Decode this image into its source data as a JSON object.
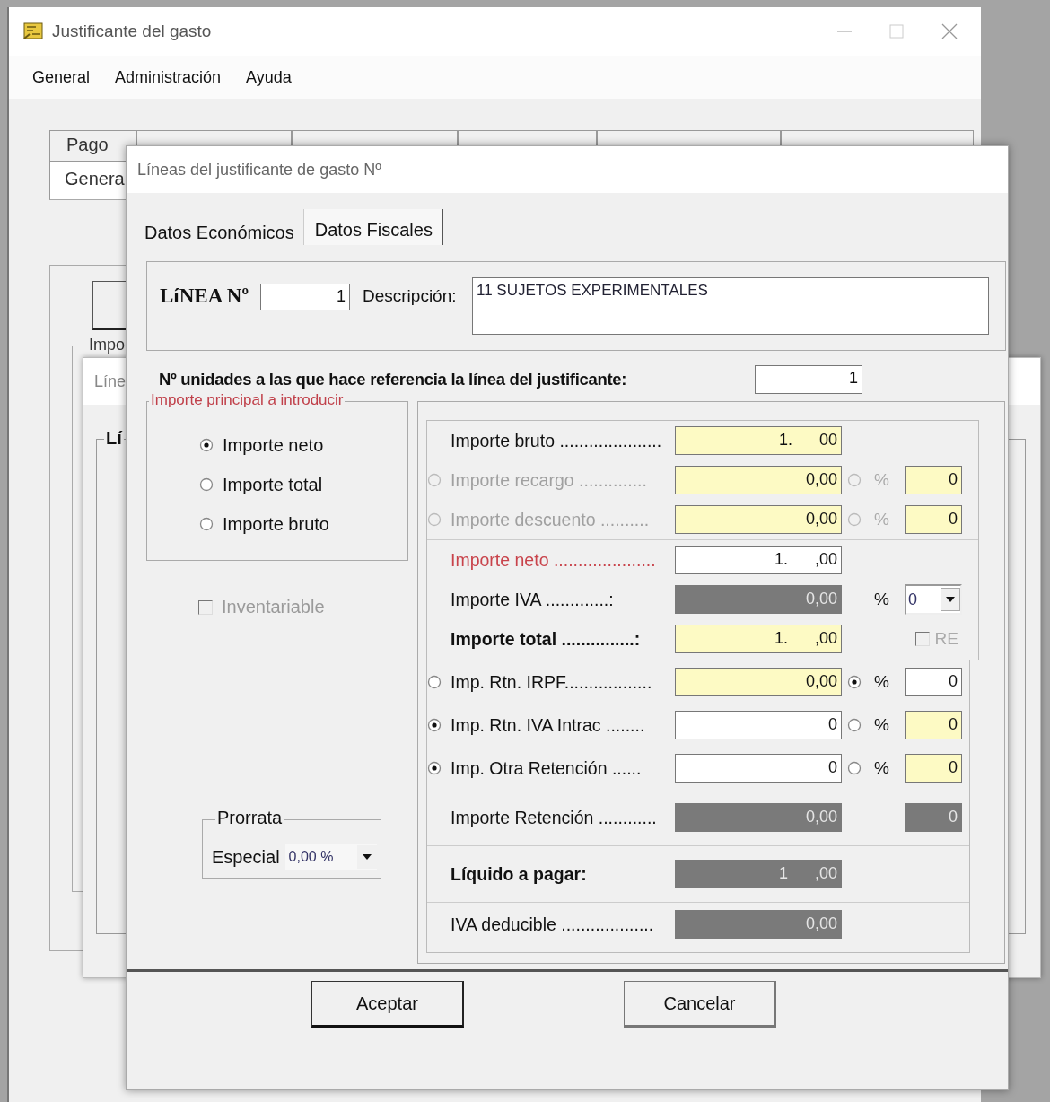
{
  "main_window": {
    "title": "Justificante del gasto",
    "menu": [
      "General",
      "Administración",
      "Ayuda"
    ],
    "tabs": [
      {
        "label": "Pago",
        "selected": false
      },
      {
        "label": "Genera",
        "selected": true
      }
    ],
    "group_label": "Impo"
  },
  "back_dialog": {
    "title": "Líne",
    "group_label": "Lí"
  },
  "dialog": {
    "title": "Líneas del justificante de gasto Nº",
    "tabs": [
      {
        "label": "Datos Económicos",
        "selected": true
      },
      {
        "label": "Datos Fiscales",
        "selected": false
      }
    ],
    "line_label": "LíNEA Nº",
    "line_value": "1",
    "description_label": "Descripción:",
    "description": "11 SUJETOS EXPERIMENTALES",
    "units_label": "Nº unidades a las que hace referencia la línea del justificante:",
    "units_value": "1",
    "principal": {
      "title": "Importe principal a introducir",
      "options": [
        {
          "label": "Importe neto",
          "selected": true
        },
        {
          "label": "Importe total",
          "selected": false
        },
        {
          "label": "Importe bruto",
          "selected": false
        }
      ]
    },
    "inventariable": {
      "label": "Inventariable",
      "checked": false,
      "disabled": true
    },
    "prorrata": {
      "title": "Prorrata",
      "label": "Especial",
      "value": "0,00 %"
    },
    "sections": [
      {
        "rows": [
          {
            "label": "Importe bruto .....................",
            "value": "1.      00",
            "highlighted": true
          },
          {
            "label": "Importe recargo ..............",
            "disabled": true,
            "radio": {
              "selected": false
            },
            "value": "0,00",
            "highlighted": true,
            "pct": {
              "radio": {
                "selected": false
              },
              "symbol": "%",
              "value": "0",
              "highlighted": true
            }
          },
          {
            "label": "Importe descuento ..........",
            "disabled": true,
            "radio": {
              "selected": false
            },
            "value": "0,00",
            "highlighted": true,
            "pct": {
              "radio": {
                "selected": false
              },
              "symbol": "%",
              "value": "0",
              "highlighted": true
            },
            "divider_after": true
          },
          {
            "label": "Importe neto .....................",
            "required": true,
            "value": "1.      ,00",
            "highlighted": false
          },
          {
            "label": "Importe IVA .............:",
            "value": "0,00",
            "readonly": true,
            "combo": {
              "symbol": "%",
              "value": "0"
            }
          },
          {
            "label": "Importe total ...............:",
            "bold": true,
            "value": "1.      ,00",
            "highlighted": true,
            "check": {
              "label": "RE",
              "checked": false,
              "disabled": true
            }
          }
        ]
      },
      {
        "rows": [
          {
            "label": "Imp. Rtn. IRPF..................",
            "radio": {
              "selected": false
            },
            "value": "0,00",
            "highlighted": true,
            "pct": {
              "radio": {
                "selected": true
              },
              "symbol": "%",
              "value": "0",
              "highlighted": false
            }
          },
          {
            "label": "Imp. Rtn. IVA Intrac ........",
            "radio": {
              "selected": true
            },
            "value": "0",
            "highlighted": false,
            "pct": {
              "radio": {
                "selected": false
              },
              "symbol": "%",
              "value": "0",
              "highlighted": true
            }
          },
          {
            "label": "Imp. Otra Retención ......",
            "radio": {
              "selected": true
            },
            "value": "0",
            "highlighted": false,
            "pct": {
              "radio": {
                "selected": false
              },
              "symbol": "%",
              "value": "0",
              "highlighted": true
            }
          },
          {
            "label": "Importe Retención ............",
            "value": "0,00",
            "readonly": true,
            "side_value": {
              "value": "0",
              "readonly": true
            },
            "divider_after": true
          },
          {
            "label": "Líquido a pagar:",
            "bold": true,
            "value": "1      ,00",
            "readonly": true,
            "divider_after": true
          },
          {
            "label": "IVA deducible ...................",
            "value": "0,00",
            "readonly": true
          }
        ]
      }
    ],
    "buttons": [
      "Aceptar",
      "Cancelar"
    ]
  }
}
